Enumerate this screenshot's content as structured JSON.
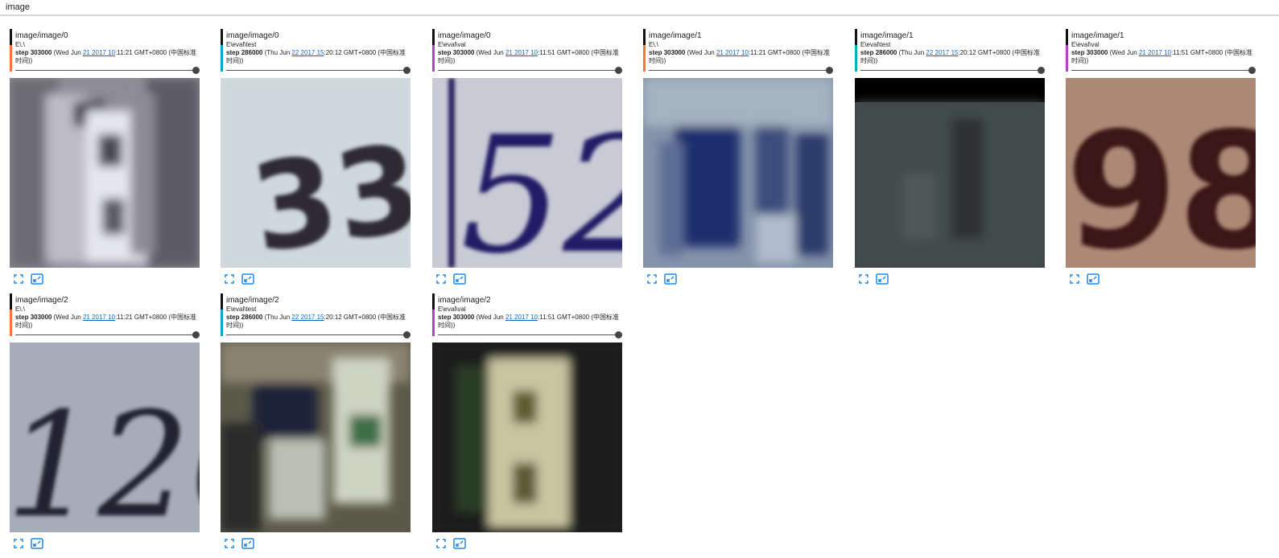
{
  "header": {
    "title": "image"
  },
  "colors": {
    "run_eval": "#ff7043",
    "run_test": "#00acc1",
    "run_val": "#ab47bc",
    "link": "#1565c0",
    "icon": "#1e88e5"
  },
  "cards": [
    {
      "tag": "image/image/0",
      "run": "E\\.\\",
      "step_label": "step",
      "step": "303000",
      "date_pre": "(Wed Jun ",
      "date_link": "21 2017 10",
      "date_post": ":11:21 GMT+0800 (中国标准时间))",
      "run_color": "run_eval",
      "image": "digits-18"
    },
    {
      "tag": "image/image/0",
      "run": "E\\eval\\test",
      "step_label": "step",
      "step": "286000",
      "date_pre": "(Thu Jun ",
      "date_link": "22 2017 15",
      "date_post": ":20:12 GMT+0800 (中国标准时间))",
      "run_color": "run_test",
      "image": "digits-33"
    },
    {
      "tag": "image/image/0",
      "run": "E\\eval\\val",
      "step_label": "step",
      "step": "303000",
      "date_pre": "(Wed Jun ",
      "date_link": "21 2017 10",
      "date_post": ":11:51 GMT+0800 (中国标准时间))",
      "run_color": "run_val",
      "image": "digits-52"
    },
    {
      "tag": "image/image/1",
      "run": "E\\.\\",
      "step_label": "step",
      "step": "303000",
      "date_pre": "(Wed Jun ",
      "date_link": "21 2017 10",
      "date_post": ":11:21 GMT+0800 (中国标准时间))",
      "run_color": "run_eval",
      "image": "digits-blurry-blue"
    },
    {
      "tag": "image/image/1",
      "run": "E\\eval\\test",
      "step_label": "step",
      "step": "286000",
      "date_pre": "(Thu Jun ",
      "date_link": "22 2017 15",
      "date_post": ":20:12 GMT+0800 (中国标准时间))",
      "run_color": "run_test",
      "image": "digits-dark-gray"
    },
    {
      "tag": "image/image/1",
      "run": "E\\eval\\val",
      "step_label": "step",
      "step": "303000",
      "date_pre": "(Wed Jun ",
      "date_link": "21 2017 10",
      "date_post": ":11:51 GMT+0800 (中国标准时间))",
      "run_color": "run_val",
      "image": "digits-98"
    },
    {
      "tag": "image/image/2",
      "run": "E\\.\\",
      "step_label": "step",
      "step": "303000",
      "date_pre": "(Wed Jun ",
      "date_link": "21 2017 10",
      "date_post": ":11:21 GMT+0800 (中国标准时间))",
      "run_color": "run_eval",
      "image": "digits-120"
    },
    {
      "tag": "image/image/2",
      "run": "E\\eval\\test",
      "step_label": "step",
      "step": "286000",
      "date_pre": "(Thu Jun ",
      "date_link": "22 2017 15",
      "date_post": ":20:12 GMT+0800 (中国标准时间))",
      "run_color": "run_test",
      "image": "digits-35"
    },
    {
      "tag": "image/image/2",
      "run": "E\\eval\\val",
      "step_label": "step",
      "step": "303000",
      "date_pre": "(Wed Jun ",
      "date_link": "21 2017 10",
      "date_post": ":11:51 GMT+0800 (中国标准时间))",
      "run_color": "run_val",
      "image": "digits-8"
    }
  ],
  "icons": {
    "fullscreen": "fullscreen-icon",
    "actual_size": "actual-size-icon"
  }
}
